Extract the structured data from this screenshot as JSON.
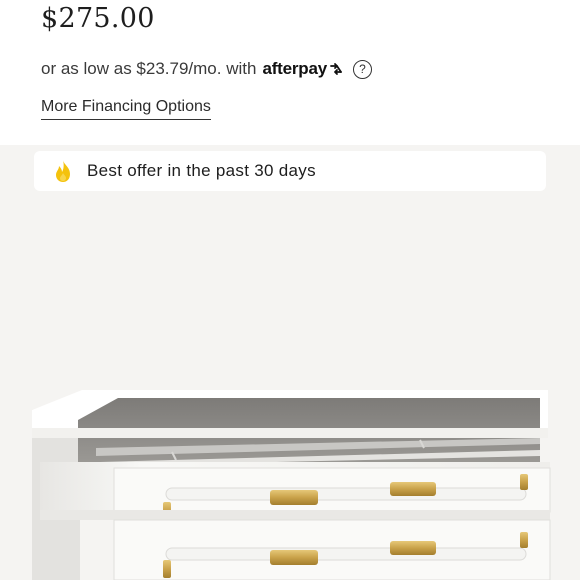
{
  "product": {
    "price": "$275.00",
    "installment_text": "or as low as $23.79/mo. with",
    "afterpay_brand": "afterpay",
    "help_symbol": "?",
    "financing_link": "More Financing Options"
  },
  "offer": {
    "icon": "flame-icon",
    "text": "Best offer in the past 30 days"
  },
  "image": {
    "subject": "white jewelry box with glass lid and gold handles"
  },
  "colors": {
    "background": "#f5f4f2",
    "panel": "#ffffff",
    "flame": "#f4c20d",
    "gold": "#c9a24a"
  }
}
